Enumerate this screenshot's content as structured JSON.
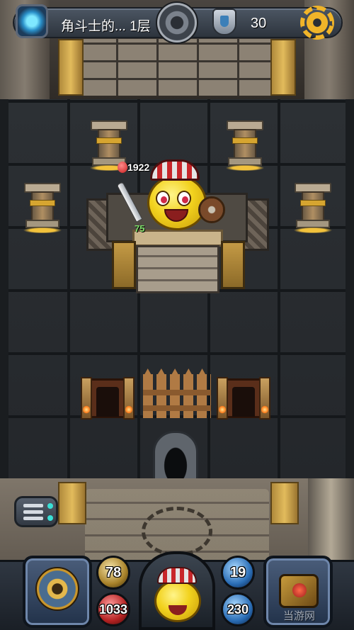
{
  "topbar": {
    "floor_name": "角斗士的... 1层",
    "key_count": "30",
    "icons": {
      "portal": "portal-icon",
      "vault": "vault-icon",
      "shield": "shield-icon",
      "settings": "gear-icon"
    }
  },
  "board": {
    "hero": {
      "hp": "1922",
      "level": "75"
    },
    "objects": [
      "pillar",
      "pillar",
      "pillar",
      "pillar",
      "arena-platform",
      "door",
      "wooden-fence",
      "door",
      "exit-gate"
    ]
  },
  "stats": {
    "attack": "78",
    "health": "1033",
    "defense": "19",
    "mana": "230"
  },
  "footer": {
    "left_slot_icon": "compass-icon",
    "right_slot_icon": "spellbook-icon",
    "watermark": "当游网"
  },
  "colors": {
    "gold": "#f0b429",
    "hp_red": "#c71d1d",
    "level_green": "#7ee06a",
    "mana_blue": "#2a6db5"
  }
}
